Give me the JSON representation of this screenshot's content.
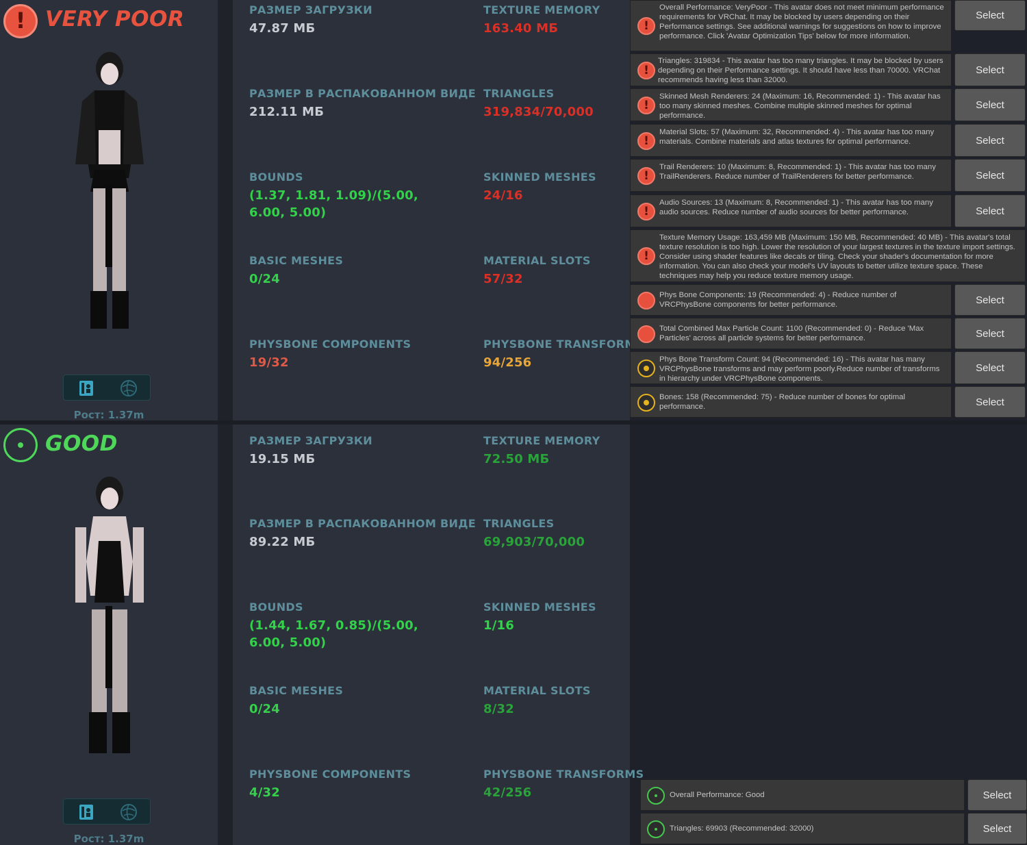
{
  "top": {
    "rating": "VERY POOR",
    "rating_color": "#e8533f",
    "height": "Рост: 1.37m",
    "stats": {
      "download_size_label": "РАЗМЕР ЗАГРУЗКИ",
      "download_size": "47.87 МБ",
      "uncompressed_label": "РАЗМЕР В РАСПАКОВАННОМ ВИДЕ",
      "uncompressed": "212.11 МБ",
      "bounds_label": "BOUNDS",
      "bounds": "(1.37, 1.81, 1.09)/(5.00, 6.00, 5.00)",
      "basic_meshes_label": "BASIC MESHES",
      "basic_meshes": "0/24",
      "physbone_components_label": "PHYSBONE COMPONENTS",
      "physbone_components": "19/32",
      "texture_memory_label": "TEXTURE MEMORY",
      "texture_memory": "163.40 МБ",
      "triangles_label": "TRIANGLES",
      "triangles": "319,834/70,000",
      "skinned_meshes_label": "SKINNED MESHES",
      "skinned_meshes": "24/16",
      "material_slots_label": "MATERIAL SLOTS",
      "material_slots": "57/32",
      "physbone_transforms_label": "PHYSBONE TRANSFORMS",
      "physbone_transforms": "94/256"
    },
    "warnings": [
      {
        "icon": "error-icon",
        "text": "Overall Performance: VeryPoor - This avatar does not meet minimum performance requirements for VRChat. It may be blocked by users depending on their Performance settings. See additional warnings for suggestions on how to improve performance. Click 'Avatar Optimization Tips' below for more information.",
        "button": "Select"
      },
      {
        "icon": "error-icon",
        "text": "Triangles: 319834 - This avatar has too many triangles. It may be blocked by users depending on their Performance settings. It should have less than 70000. VRChat recommends having less than 32000.",
        "button": "Select"
      },
      {
        "icon": "error-icon",
        "text": "Skinned Mesh Renderers: 24 (Maximum: 16, Recommended: 1) - This avatar has too many skinned meshes. Combine multiple skinned meshes for optimal performance.",
        "button": "Select"
      },
      {
        "icon": "error-icon",
        "text": "Material Slots: 57 (Maximum: 32, Recommended: 4) - This avatar has too many materials. Combine materials and atlas textures for optimal performance.",
        "button": "Select"
      },
      {
        "icon": "error-icon",
        "text": "Trail Renderers: 10 (Maximum: 8, Recommended: 1) - This avatar has too many TrailRenderers. Reduce number of TrailRenderers for better performance.",
        "button": "Select"
      },
      {
        "icon": "error-icon",
        "text": "Audio Sources: 13 (Maximum: 8, Recommended: 1) - This avatar has too many audio sources. Reduce number of audio sources for better performance.",
        "button": "Select"
      },
      {
        "icon": "error-icon",
        "text": "Texture Memory Usage: 163,459 MB (Maximum: 150 MB, Recommended: 40 MB) - This avatar's total texture resolution is too high. Lower the resolution of your largest textures in the texture import settings. Consider using shader features like decals or tiling. Check your shader's documentation for more information. You can also check your model's UV layouts to better utilize texture space. These techniques may help you reduce texture memory usage."
      },
      {
        "icon": "poor-dot-icon",
        "text": "Phys Bone Components: 19 (Recommended: 4) - Reduce number of VRCPhysBone components for better performance.",
        "button": "Select"
      },
      {
        "icon": "poor-dot-icon",
        "text": "Total Combined Max Particle Count: 1100 (Recommended: 0) - Reduce 'Max Particles' across all particle systems for better performance.",
        "button": "Select"
      },
      {
        "icon": "medium-icon",
        "text": "Phys Bone Transform Count: 94 (Recommended: 16) - This avatar has many VRCPhysBone transforms and may perform poorly.Reduce number of transforms in hierarchy under VRCPhysBone components.",
        "button": "Select"
      },
      {
        "icon": "medium-icon",
        "text": "Bones: 158 (Recommended: 75) - Reduce number of bones for optimal performance.",
        "button": "Select"
      }
    ]
  },
  "bottom": {
    "rating": "GOOD",
    "rating_color": "#4fd75a",
    "height": "Рост: 1.37m",
    "stats": {
      "download_size_label": "РАЗМЕР ЗАГРУЗКИ",
      "download_size": "19.15 МБ",
      "uncompressed_label": "РАЗМЕР В РАСПАКОВАННОМ ВИДЕ",
      "uncompressed": "89.22 МБ",
      "bounds_label": "BOUNDS",
      "bounds": "(1.44, 1.67, 0.85)/(5.00, 6.00, 5.00)",
      "basic_meshes_label": "BASIC MESHES",
      "basic_meshes": "0/24",
      "physbone_components_label": "PHYSBONE COMPONENTS",
      "physbone_components": "4/32",
      "texture_memory_label": "TEXTURE MEMORY",
      "texture_memory": "72.50 МБ",
      "triangles_label": "TRIANGLES",
      "triangles": "69,903/70,000",
      "skinned_meshes_label": "SKINNED MESHES",
      "skinned_meshes": "1/16",
      "material_slots_label": "MATERIAL SLOTS",
      "material_slots": "8/32",
      "physbone_transforms_label": "PHYSBONE TRANSFORMS",
      "physbone_transforms": "42/256"
    },
    "warnings": [
      {
        "icon": "good-icon",
        "text": "Overall Performance: Good",
        "button": "Select"
      },
      {
        "icon": "good-icon",
        "text": "Triangles: 69903 (Recommended: 32000)",
        "button": "Select"
      }
    ]
  }
}
